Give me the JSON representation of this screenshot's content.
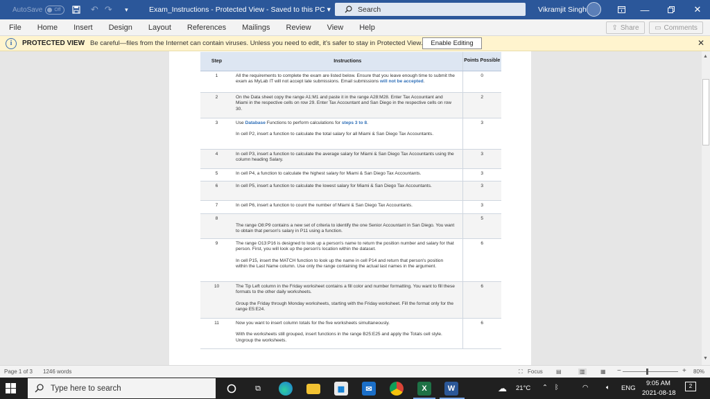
{
  "titlebar": {
    "autosave_label": "AutoSave",
    "autosave_state": "Off",
    "doc_title": "Exam_Instructions  -  Protected View  -  Saved to this PC  ▾",
    "search_placeholder": "Search",
    "user_name": "Vikramjit Singh"
  },
  "ribbon": {
    "tabs": [
      "File",
      "Home",
      "Insert",
      "Design",
      "Layout",
      "References",
      "Mailings",
      "Review",
      "View",
      "Help"
    ],
    "share_label": "Share",
    "comments_label": "Comments"
  },
  "protected_view": {
    "title": "PROTECTED VIEW",
    "message": "Be careful—files from the Internet can contain viruses. Unless you need to edit, it's safer to stay in Protected View.",
    "enable_label": "Enable Editing"
  },
  "table": {
    "header_step": "Step",
    "header_instructions": "Instructions",
    "header_points": "Points Possible",
    "rows": [
      {
        "step": "1",
        "points": "0",
        "p1a": "All the requirements to complete the exam are listed below. Ensure that you leave enough time to submit the exam as MyLab IT will not accept late submissions. Email submissions ",
        "p1b": "will not be accepted",
        "p1c": "."
      },
      {
        "step": "2",
        "points": "2",
        "p1": "On the Data sheet copy the range A1:M1 and paste it in the range A28:M28. Enter Tax Accountant and Miami in the respective cells on row 29. Enter Tax Accountant and San Diego in the respective cells on row 30."
      },
      {
        "step": "3",
        "points": "3",
        "p1a": "Use ",
        "p1b": "Database",
        "p1c": " Functions to perform calculations for ",
        "p1d": "steps 3 to 8",
        "p1e": ".",
        "p2": "In cell P2, insert a function to calculate the total salary for all Miami & San Diego Tax Accountants."
      },
      {
        "step": "4",
        "points": "3",
        "p1": "In cell P3, insert a function to calculate the average salary for Miami & San Diego Tax Accountants using the column heading Salary."
      },
      {
        "step": "5",
        "points": "3",
        "p1": "In cell P4, a function to calculate the highest salary for Miami & San Diego Tax Accountants."
      },
      {
        "step": "6",
        "points": "3",
        "p1": "In cell P5, insert a function to calculate the lowest salary for Miami & San Diego Tax Accountants."
      },
      {
        "step": "7",
        "points": "3",
        "p1": "In cell P6, insert a function to count the number of Miami & San Diego Tax Accountants."
      },
      {
        "step": "8",
        "points": "5",
        "p1": "The range O8:P9 contains a new set of criteria to identify the one Senior Accountant in San Diego. You want to obtain that person's salary in P11 using a function."
      },
      {
        "step": "9",
        "points": "6",
        "p1": "The range O13:P16 is designed to look up a person's name to return the position number and salary for that person. First, you will look up the person's location within the dataset.",
        "p2": "In cell P15, insert the MATCH function to look up the name in cell P14 and return that person's position within the Last Name column. Use only the range containing the actual last names in the argument."
      },
      {
        "step": "10",
        "points": "6",
        "p1": "The Tip Left column in the Friday worksheet contains a fill color and number formatting. You want to fill these formats to the other daily worksheets.",
        "p2": "Group the Friday through Monday worksheets, starting with the Friday worksheet. Fill the format only for the range E5:E24."
      },
      {
        "step": "11",
        "points": "6",
        "p1": "Now you want to insert column totals for the five worksheets simultaneously.",
        "p2": "With the worksheets still grouped, insert functions in the range B25:E25 and apply the Totals cell style. Ungroup the worksheets."
      }
    ]
  },
  "statusbar": {
    "page": "Page 1 of 3",
    "words": "1246 words",
    "focus": "Focus",
    "zoom": "80%",
    "zoom_minus": "−",
    "zoom_plus": "+"
  },
  "taskbar": {
    "search_placeholder": "Type here to search",
    "weather": "21°C",
    "lang": "ENG",
    "time": "9:05 AM",
    "date": "2021-08-18",
    "notif_count": "2"
  }
}
